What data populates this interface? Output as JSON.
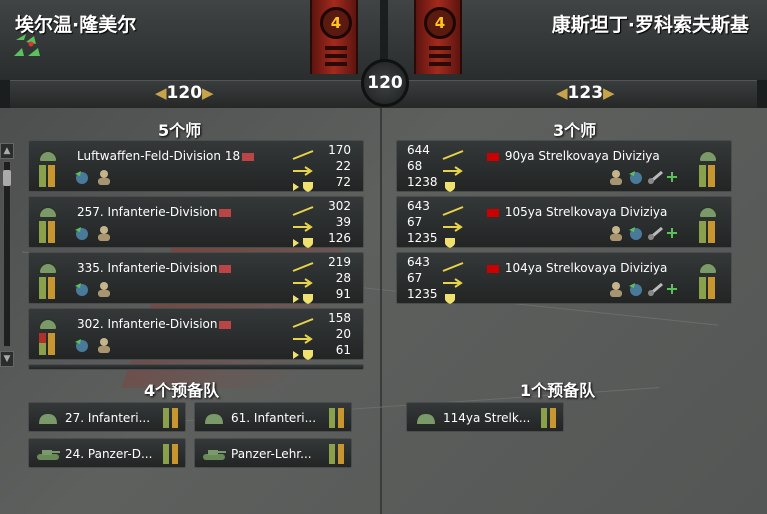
{
  "attacker": {
    "commander": "埃尔温·隆美尔",
    "rank": "4",
    "strength": "120",
    "divisions_title": "5个师",
    "reserves_title": "4个预备队",
    "divisions": [
      {
        "name": "Luftwaffen-Feld-Division 18",
        "soft": "170",
        "hard": "22",
        "def": "72",
        "str": 1.0,
        "org": 1.0
      },
      {
        "name": "257. Infanterie-Division",
        "soft": "302",
        "hard": "39",
        "def": "126",
        "str": 1.0,
        "org": 1.0
      },
      {
        "name": "335. Infanterie-Division",
        "soft": "219",
        "hard": "28",
        "def": "91",
        "str": 1.0,
        "org": 1.0
      },
      {
        "name": "302. Infanterie-Division",
        "soft": "158",
        "hard": "20",
        "def": "61",
        "str": 0.55,
        "org": 1.0
      }
    ],
    "reserves": [
      {
        "name": "27. Infanteri...",
        "type": "infantry-icon"
      },
      {
        "name": "61. Infanteri...",
        "type": "infantry-icon"
      },
      {
        "name": "24. Panzer-D...",
        "type": "tank-icon"
      },
      {
        "name": "Panzer-Lehr...",
        "type": "tank-icon"
      }
    ]
  },
  "defender": {
    "commander": "康斯坦丁·罗科索夫斯基",
    "rank": "4",
    "strength": "123",
    "divisions_title": "3个师",
    "reserves_title": "1个预备队",
    "divisions": [
      {
        "name": "90ya Strelkovaya Diviziya",
        "soft": "644",
        "hard": "68",
        "def": "1238",
        "str": 1.0,
        "org": 1.0
      },
      {
        "name": "105ya Strelkovaya Diviziya",
        "soft": "643",
        "hard": "67",
        "def": "1235",
        "str": 1.0,
        "org": 1.0
      },
      {
        "name": "104ya Strelkovaya Diviziya",
        "soft": "643",
        "hard": "67",
        "def": "1235",
        "str": 1.0,
        "org": 1.0
      }
    ],
    "reserves": [
      {
        "name": "114ya Strelk...",
        "type": "infantry-icon"
      }
    ]
  },
  "center_value": "120",
  "colors": {
    "strength": "#8aa04a",
    "organization": "#c8962e",
    "rank_red": "#a42a1d",
    "rank_text": "#ffc31d"
  }
}
